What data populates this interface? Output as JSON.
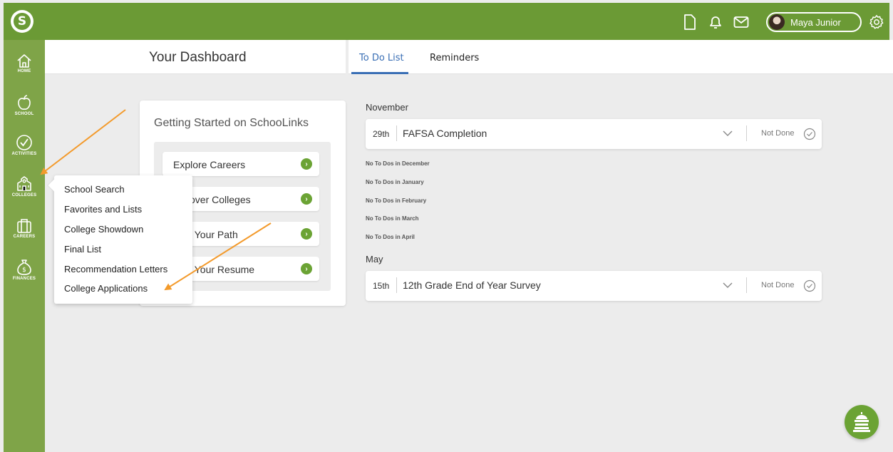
{
  "topbar": {
    "logo": "schoollinks-logo-icon",
    "icons": [
      "document-icon",
      "bell-icon",
      "mail-icon",
      "gear-icon"
    ],
    "user_name": "Maya Junior",
    "bar_color": "#6b9a35"
  },
  "sidebar": {
    "items": [
      {
        "label": "HOME",
        "icon": "home-icon"
      },
      {
        "label": "SCHOOL",
        "icon": "apple-icon"
      },
      {
        "label": "ACTIVITIES",
        "icon": "check-circle-icon"
      },
      {
        "label": "COLLEGES",
        "icon": "college-building-icon"
      },
      {
        "label": "CAREERS",
        "icon": "briefcase-icon"
      },
      {
        "label": "FINANCES",
        "icon": "money-bag-icon"
      }
    ]
  },
  "header": {
    "title": "Your Dashboard",
    "tabs": [
      {
        "label": "To Do List",
        "active": true
      },
      {
        "label": "Reminders",
        "active": false
      }
    ]
  },
  "getting_started": {
    "title": "Getting Started on SchooLinks",
    "items": [
      {
        "label": "Explore Careers"
      },
      {
        "label": "over Colleges"
      },
      {
        "label": "l Your Path"
      },
      {
        "label": "l Your Resume"
      }
    ]
  },
  "colleges_menu": {
    "items": [
      {
        "label": "School Search"
      },
      {
        "label": "Favorites and Lists"
      },
      {
        "label": "College Showdown"
      },
      {
        "label": "Final List"
      },
      {
        "label": "Recommendation Letters"
      },
      {
        "label": "College Applications"
      }
    ]
  },
  "todo": {
    "november": {
      "month": "November",
      "date": "29th",
      "title": "FAFSA Completion",
      "status": "Not Done"
    },
    "empty_months": [
      "No To Dos in December",
      "No To Dos in January",
      "No To Dos in February",
      "No To Dos in March",
      "No To Dos in April"
    ],
    "may": {
      "month": "May",
      "date": "15th",
      "title": "12th Grade End of Year Survey",
      "status": "Not Done"
    }
  },
  "fab": {
    "icon": "capitol-building-icon"
  },
  "colors": {
    "accent_green": "#6ba334",
    "link_blue": "#3a6fb5",
    "annotation_orange": "#f39a2b"
  }
}
